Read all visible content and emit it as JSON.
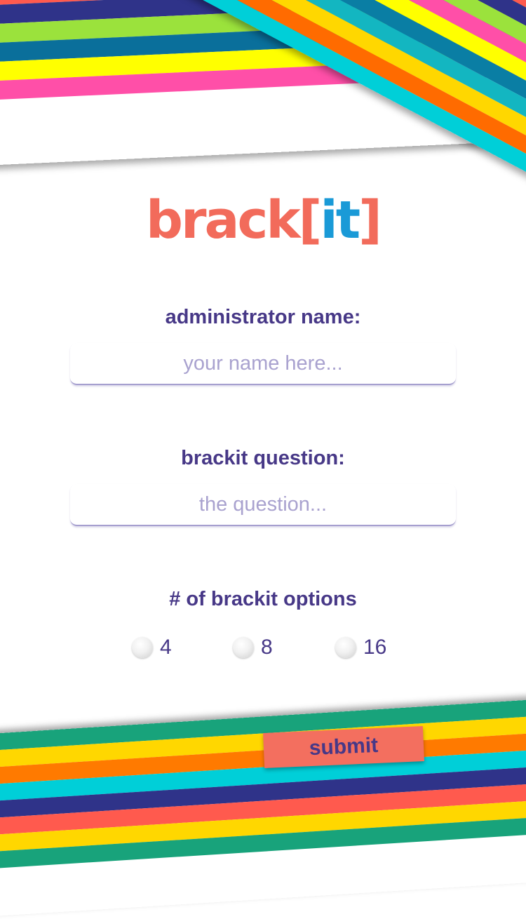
{
  "colors": {
    "brand_coral": "#f26b5b",
    "brand_blue": "#1a9ad7",
    "text_purple": "#473887",
    "placeholder_lavender": "#a9a2cf"
  },
  "top_stripes": [
    "#13b6c1",
    "#ffd700",
    "#ff6b00",
    "#00cfd8",
    "#0a7ea4",
    "#ff5a4e",
    "#2f3389",
    "#9be23c",
    "#0a6f9b",
    "#ffff00",
    "#ff4fa8"
  ],
  "diagonal_stripes": [
    "#ff5a4e",
    "#2f3389",
    "#9be23c",
    "#ff4fa8",
    "#ffff00",
    "#0a7ea4",
    "#13b6c1",
    "#ffd700",
    "#ff6b00",
    "#00cfd8"
  ],
  "bottom_stripes": [
    "#18a37b",
    "#ffd700",
    "#ff7a00",
    "#00cfd8",
    "#2f3389",
    "#ff5a4e",
    "#ffd700",
    "#18a37b"
  ],
  "logo": {
    "word": "brack",
    "open_bracket": "[",
    "highlight": "it",
    "close_bracket": "]"
  },
  "form": {
    "admin_label": "administrator name:",
    "admin_placeholder": "your name here...",
    "question_label": "brackit question:",
    "question_placeholder": "the question...",
    "options_label": "# of brackit options",
    "options": [
      "4",
      "8",
      "16"
    ],
    "submit_label": "submit"
  }
}
